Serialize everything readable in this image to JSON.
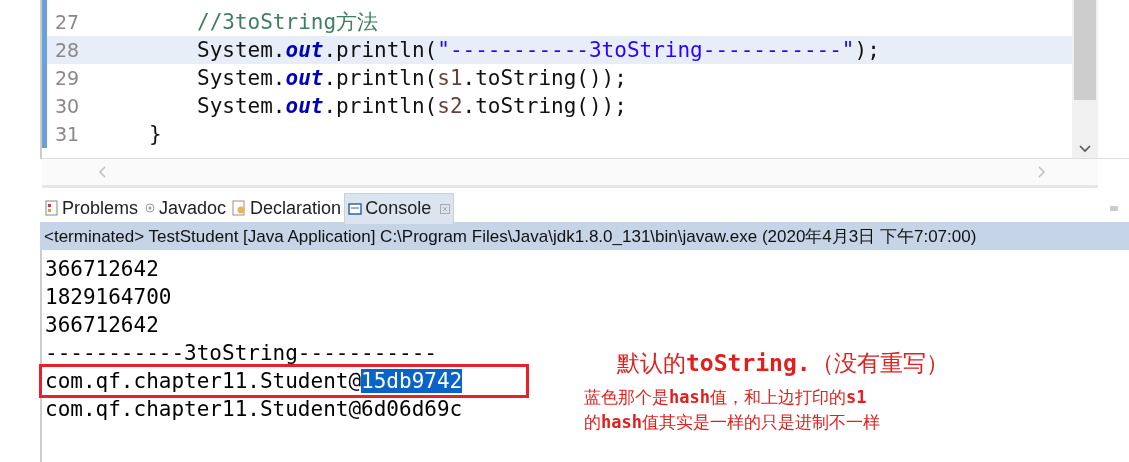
{
  "editor": {
    "lines": [
      {
        "number": "27",
        "current": false,
        "tokens": [
          {
            "kind": "comment",
            "text": "//3toString方法"
          }
        ]
      },
      {
        "number": "28",
        "current": true,
        "tokens": [
          {
            "kind": "plain",
            "text": "System."
          },
          {
            "kind": "field",
            "text": "out"
          },
          {
            "kind": "plain",
            "text": ".println("
          },
          {
            "kind": "string",
            "text": "\"-----------3toString-----------\""
          },
          {
            "kind": "plain",
            "text": ");"
          }
        ]
      },
      {
        "number": "29",
        "current": false,
        "tokens": [
          {
            "kind": "plain",
            "text": "System."
          },
          {
            "kind": "field",
            "text": "out"
          },
          {
            "kind": "plain",
            "text": ".println("
          },
          {
            "kind": "variable",
            "text": "s1"
          },
          {
            "kind": "plain",
            "text": ".toString());"
          }
        ]
      },
      {
        "number": "30",
        "current": false,
        "tokens": [
          {
            "kind": "plain",
            "text": "System."
          },
          {
            "kind": "field",
            "text": "out"
          },
          {
            "kind": "plain",
            "text": ".println("
          },
          {
            "kind": "variable",
            "text": "s2"
          },
          {
            "kind": "plain",
            "text": ".toString());"
          }
        ]
      },
      {
        "number": "31",
        "current": false,
        "tokens": [
          {
            "kind": "brace",
            "text": "}"
          }
        ]
      }
    ]
  },
  "tabs": [
    {
      "label": "Problems",
      "selected": false
    },
    {
      "label": "Javadoc",
      "selected": false
    },
    {
      "label": "Declaration",
      "selected": false
    },
    {
      "label": "Console",
      "selected": true
    }
  ],
  "console": {
    "status": "<terminated> TestStudent [Java Application] C:\\Program Files\\Java\\jdk1.8.0_131\\bin\\javaw.exe (2020年4月3日 下午7:07:00)",
    "lines": [
      {
        "boxed": false,
        "segments": [
          {
            "text": "366712642",
            "selected": false
          }
        ]
      },
      {
        "boxed": false,
        "segments": [
          {
            "text": "1829164700",
            "selected": false
          }
        ]
      },
      {
        "boxed": false,
        "segments": [
          {
            "text": "366712642",
            "selected": false
          }
        ]
      },
      {
        "boxed": false,
        "segments": [
          {
            "text": "-----------3toString-----------",
            "selected": false
          }
        ]
      },
      {
        "boxed": true,
        "segments": [
          {
            "text": "com.qf.chapter11.Student@",
            "selected": false
          },
          {
            "text": "15db9742",
            "selected": true
          }
        ]
      },
      {
        "boxed": false,
        "segments": [
          {
            "text": "com.qf.chapter11.Student@6d06d69c",
            "selected": false
          }
        ]
      }
    ]
  },
  "annotation": {
    "title": "默认的**toString.**（没有重写）",
    "notes": [
      "蓝色那个是**hash**值，和上边打印的**s1**",
      "的**hash**值其实是一样的只是进制不一样"
    ]
  }
}
